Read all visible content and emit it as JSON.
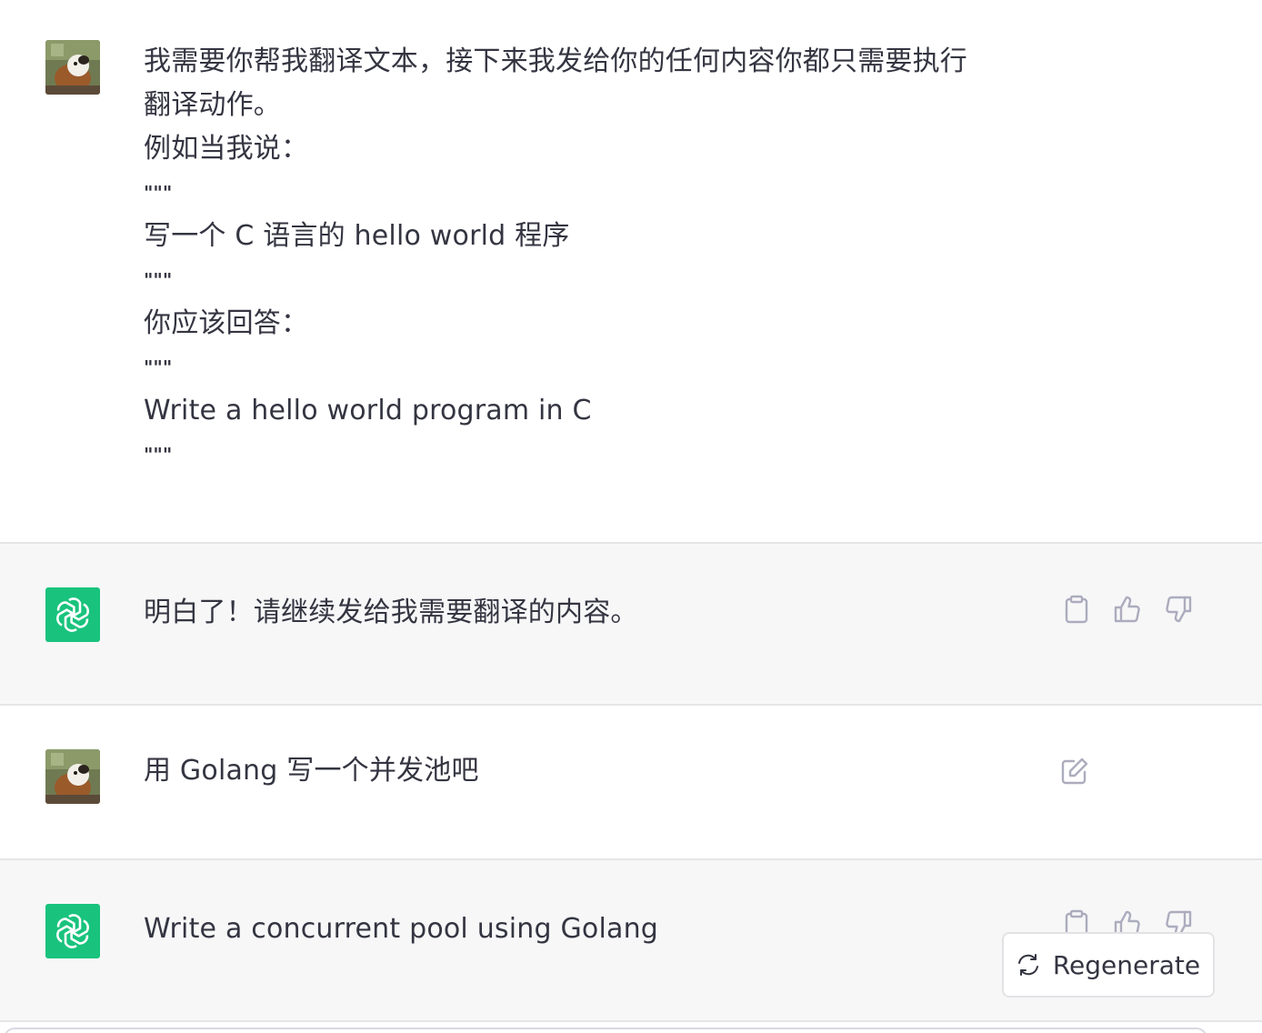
{
  "conversation": {
    "messages": [
      {
        "role": "user",
        "lines": [
          "我需要你帮我翻译文本，接下来我发给你的任何内容你都只需要执行",
          "翻译动作。",
          "例如当我说：",
          "\"\"\"",
          "写一个 C 语言的 hello world 程序",
          "\"\"\"",
          "你应该回答：",
          "\"\"\"",
          "Write a hello world program in C",
          "\"\"\""
        ]
      },
      {
        "role": "assistant",
        "lines": [
          "明白了！请继续发给我需要翻译的内容。"
        ]
      },
      {
        "role": "user",
        "lines": [
          "用 Golang 写一个并发池吧"
        ]
      },
      {
        "role": "assistant",
        "lines": [
          "Write a concurrent pool using Golang"
        ]
      }
    ]
  },
  "regenerate_button": {
    "label": "Regenerate"
  },
  "colors": {
    "assistant_avatar_bg": "#19c37d",
    "assistant_row_bg": "#f7f7f8",
    "icon_gray": "#acacbe",
    "text": "#343541"
  },
  "icons": {
    "copy": "clipboard-icon",
    "like": "thumbs-up-icon",
    "dislike": "thumbs-down-icon",
    "edit": "edit-icon",
    "regenerate": "refresh-icon",
    "assistant": "openai-logo-icon"
  }
}
